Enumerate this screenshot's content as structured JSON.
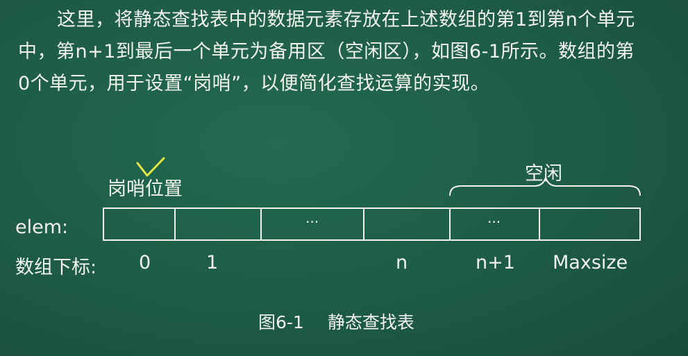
{
  "paragraph": "这里，将静态查找表中的数据元素存放在上述数组的第1到第n个单元中，第n+1到最后一个单元为备用区（空闲区），如图6-1所示。数组的第0个单元，用于设置“岗哨”，以便简化查找运算的实现。",
  "diagram": {
    "sentinel_label": "岗哨位置",
    "free_label": "空闲",
    "row_label": "elem:",
    "index_label": "数组下标:",
    "cells": [
      "",
      "",
      "···",
      "",
      "···",
      ""
    ],
    "indices": [
      "0",
      "1",
      "n",
      "n+1",
      "Maxsize"
    ]
  },
  "caption": {
    "number": "图6-1",
    "title": "静态查找表"
  },
  "colors": {
    "board": "#1d5a45",
    "chalk": "#f2f2ee",
    "check_mark": "#e6e645"
  }
}
